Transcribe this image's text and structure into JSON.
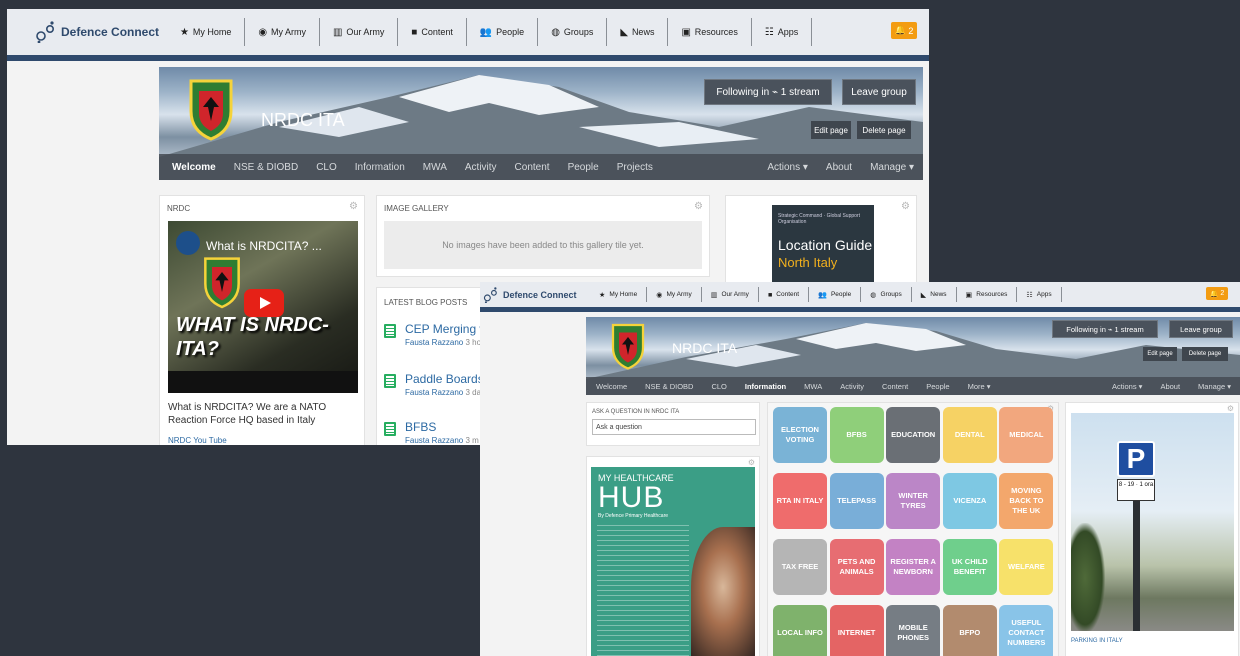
{
  "back_window": {
    "topnav": {
      "logo": "Defence Connect",
      "items": [
        {
          "label": "My Home",
          "icon": "star-icon"
        },
        {
          "label": "My Army",
          "icon": "user-circle-icon"
        },
        {
          "label": "Our Army",
          "icon": "bank-icon"
        },
        {
          "label": "Content",
          "icon": "folder-icon"
        },
        {
          "label": "People",
          "icon": "people-icon"
        },
        {
          "label": "Groups",
          "icon": "globe-icon"
        },
        {
          "label": "News",
          "icon": "megaphone-icon"
        },
        {
          "label": "Resources",
          "icon": "briefcase-icon"
        },
        {
          "label": "Apps",
          "icon": "grid-icon"
        }
      ],
      "notifications": "2"
    },
    "banner": {
      "group_name": "NRDC ITA",
      "following": "Following in ⌁ 1 stream",
      "leave": "Leave group",
      "edit": "Edit page",
      "delete": "Delete page",
      "tabs": [
        "Welcome",
        "NSE & DIOBD",
        "CLO",
        "Information",
        "MWA",
        "Activity",
        "Content",
        "People",
        "Projects"
      ],
      "right_tabs": [
        "Actions ▾",
        "About",
        "Manage ▾"
      ]
    },
    "nrdc_tile": {
      "label": "NRDC",
      "video_title": "What is NRDCITA? ...",
      "video_big": "WHAT IS NRDC-ITA?",
      "description": "What is NRDCITA? We are a NATO Reaction Force HQ based in Italy",
      "link": "NRDC You Tube"
    },
    "gallery": {
      "label": "IMAGE GALLERY",
      "empty": "No images have been added to this gallery tile yet."
    },
    "blog": {
      "label": "LATEST BLOG POSTS",
      "posts": [
        {
          "title": "CEP Merging wit",
          "author": "Fausta Razzano",
          "time": "3 ho"
        },
        {
          "title": "Paddle Boards",
          "author": "Fausta Razzano",
          "time": "3 da"
        },
        {
          "title": "BFBS",
          "author": "Fausta Razzano",
          "time": "3 m"
        }
      ]
    },
    "guide": {
      "small": "Strategic Command · Global Support Organisation",
      "title": "Location Guide",
      "subtitle": "North Italy"
    }
  },
  "front_window": {
    "topnav": {
      "logo": "Defence Connect",
      "items": [
        {
          "label": "My Home",
          "icon": "star-icon"
        },
        {
          "label": "My Army",
          "icon": "user-circle-icon"
        },
        {
          "label": "Our Army",
          "icon": "bank-icon"
        },
        {
          "label": "Content",
          "icon": "folder-icon"
        },
        {
          "label": "People",
          "icon": "people-icon"
        },
        {
          "label": "Groups",
          "icon": "globe-icon"
        },
        {
          "label": "News",
          "icon": "megaphone-icon"
        },
        {
          "label": "Resources",
          "icon": "briefcase-icon"
        },
        {
          "label": "Apps",
          "icon": "grid-icon"
        }
      ],
      "notifications": "2"
    },
    "banner": {
      "group_name": "NRDC ITA",
      "following": "Following in ⌁ 1 stream",
      "leave": "Leave group",
      "edit": "Edit page",
      "delete": "Delete page",
      "tabs": [
        "Welcome",
        "NSE & DIOBD",
        "CLO",
        "Information",
        "MWA",
        "Activity",
        "Content",
        "People",
        "More ▾"
      ],
      "right_tabs": [
        "Actions ▾",
        "About",
        "Manage ▾"
      ]
    },
    "ask": {
      "label": "ASK A QUESTION IN NRDC ITA",
      "placeholder": "Ask a question"
    },
    "hub": {
      "line1": "MY HEALTHCARE",
      "line2": "HUB",
      "line3": "By Defence Primary Healthcare"
    },
    "tiles": [
      {
        "label": "ELECTION VOTING",
        "color": "#7ab3d6"
      },
      {
        "label": "BFBS",
        "color": "#8fcf7a"
      },
      {
        "label": "EDUCATION",
        "color": "#6a6f75"
      },
      {
        "label": "DENTAL",
        "color": "#f6d264"
      },
      {
        "label": "MEDICAL",
        "color": "#f2a77e"
      },
      {
        "label": "RTA IN ITALY",
        "color": "#ef6c6c"
      },
      {
        "label": "TELEPASS",
        "color": "#79aed8"
      },
      {
        "label": "WINTER TYRES",
        "color": "#bb86c7"
      },
      {
        "label": "VICENZA",
        "color": "#7ec8e3"
      },
      {
        "label": "MOVING BACK TO THE UK",
        "color": "#f3a76c"
      },
      {
        "label": "TAX FREE",
        "color": "#b5b5b5"
      },
      {
        "label": "PETS AND ANIMALS",
        "color": "#e76d72"
      },
      {
        "label": "REGISTER A NEWBORN",
        "color": "#c382c4"
      },
      {
        "label": "UK CHILD BENEFIT",
        "color": "#6fcf8c"
      },
      {
        "label": "WELFARE",
        "color": "#f7e16a"
      },
      {
        "label": "LOCAL INFO",
        "color": "#7fb26c"
      },
      {
        "label": "INTERNET",
        "color": "#e46464"
      },
      {
        "label": "MOBILE PHONES",
        "color": "#767d84"
      },
      {
        "label": "BFPO",
        "color": "#b28b6e"
      },
      {
        "label": "USEFUL CONTACT NUMBERS",
        "color": "#89c4e8"
      }
    ],
    "photo": {
      "sign_letter": "P",
      "sign_text": "8 - 19 · 1 ora",
      "caption": "PARKING IN ITALY"
    }
  }
}
